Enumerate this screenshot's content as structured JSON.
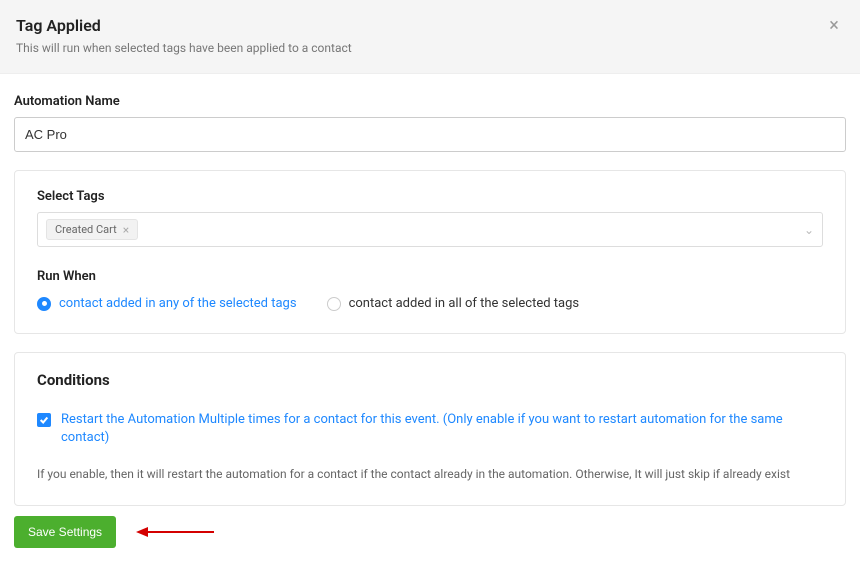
{
  "header": {
    "title": "Tag Applied",
    "subtitle": "This will run when selected tags have been applied to a contact"
  },
  "form": {
    "automation_name_label": "Automation Name",
    "automation_name_value": "AC Pro"
  },
  "tags": {
    "label": "Select Tags",
    "selected": [
      "Created Cart"
    ]
  },
  "run_when": {
    "label": "Run When",
    "options": [
      {
        "label": "contact added in any of the selected tags",
        "selected": true
      },
      {
        "label": "contact added in all of the selected tags",
        "selected": false
      }
    ]
  },
  "conditions": {
    "title": "Conditions",
    "restart_label": "Restart the Automation Multiple times for a contact for this event. (Only enable if you want to restart automation for the same contact)",
    "restart_checked": true,
    "helper": "If you enable, then it will restart the automation for a contact if the contact already in the automation. Otherwise, It will just skip if already exist"
  },
  "footer": {
    "save_label": "Save Settings"
  }
}
